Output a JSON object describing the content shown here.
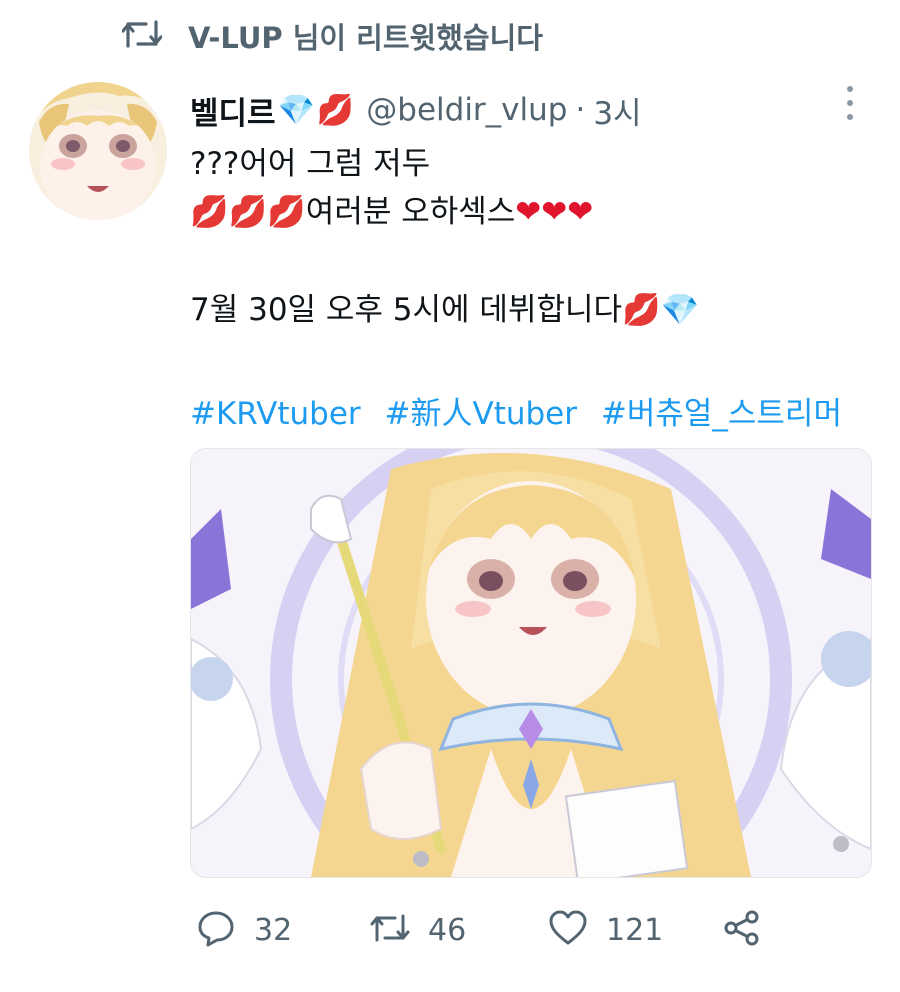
{
  "retweet_banner": {
    "icon": "retweet-icon",
    "text": "V-LUP 님이 리트윗했습니다"
  },
  "tweet": {
    "display_name": "벨디르",
    "name_emojis": [
      "💎",
      "💋"
    ],
    "handle": "@beldir_vlup",
    "separator": "·",
    "time": "3시",
    "lines": [
      {
        "text": "???어어 그럼 저두"
      },
      {
        "prefix": "💋💋💋",
        "text": "여러분 오하섹스",
        "suffix": "❤❤❤"
      },
      {
        "text": "7월 30일 오후 5시에 데뷔합니다",
        "suffix": "💋💎"
      }
    ],
    "hashtags": [
      "#KRVtuber",
      "#新人Vtuber",
      "#버츄얼_스트리머"
    ]
  },
  "actions": {
    "reply": {
      "icon": "reply-icon",
      "count": "32"
    },
    "retweet": {
      "icon": "retweet-icon",
      "count": "46"
    },
    "like": {
      "icon": "heart-icon",
      "count": "121"
    },
    "share": {
      "icon": "share-icon"
    }
  },
  "colors": {
    "link": "#1d9bf0",
    "secondary_text": "#536471",
    "primary_text": "#0f1419"
  }
}
